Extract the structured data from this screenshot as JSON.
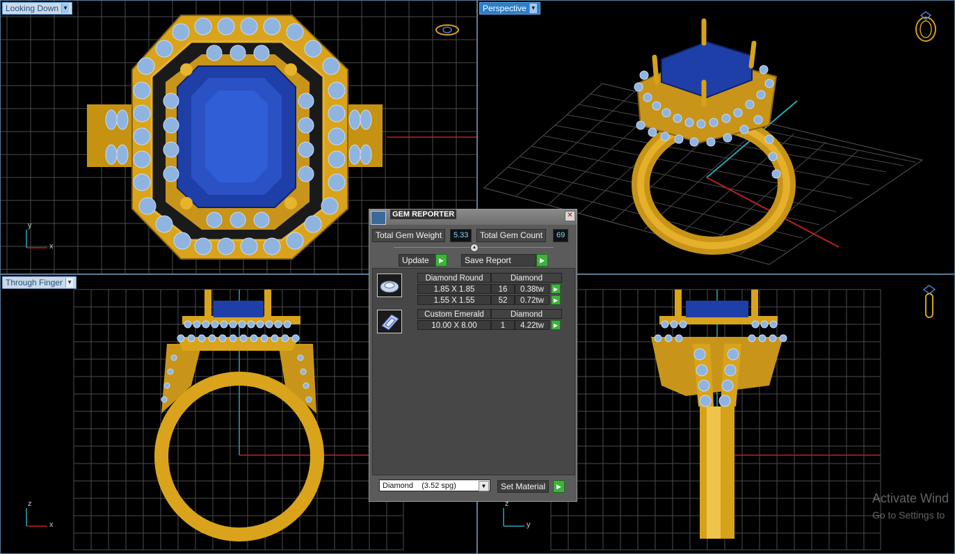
{
  "viewports": {
    "top_left": {
      "label": "Looking Down",
      "axis_h": "x",
      "axis_v": "y"
    },
    "top_right": {
      "label": "Perspective"
    },
    "bottom_left": {
      "label": "Through Finger",
      "axis_h": "x",
      "axis_v": "z"
    },
    "bottom_right": {
      "axis_h": "y",
      "axis_v": "z"
    }
  },
  "gem_reporter": {
    "title": "GEM REPORTER",
    "total_weight_label": "Total Gem Weight",
    "total_weight_value": "5.33",
    "total_count_label": "Total Gem Count",
    "total_count_value": "69",
    "update_label": "Update",
    "save_report_label": "Save Report",
    "groups": [
      {
        "shape": "Diamond Round",
        "material": "Diamond",
        "rows": [
          {
            "size": "1.85 X 1.85",
            "count": "16",
            "weight": "0.38tw"
          },
          {
            "size": "1.55 X 1.55",
            "count": "52",
            "weight": "0.72tw"
          }
        ]
      },
      {
        "shape": "Custom Emerald",
        "material": "Diamond",
        "rows": [
          {
            "size": "10.00 X 8.00",
            "count": "1",
            "weight": "4.22tw"
          }
        ]
      }
    ],
    "material_select": "Diamond    (3.52 spg)",
    "set_material_label": "Set Material"
  },
  "watermark": {
    "line1": "Activate Wind",
    "line2": "Go to Settings to"
  },
  "colors": {
    "gold": "#d6a21a",
    "sapphire": "#1f3fa8",
    "diamond": "#8fb4e0",
    "grid": "#555555",
    "axis_red": "#c02020",
    "axis_cyan": "#2aa6b8",
    "active_label": "#2c7fc8"
  }
}
